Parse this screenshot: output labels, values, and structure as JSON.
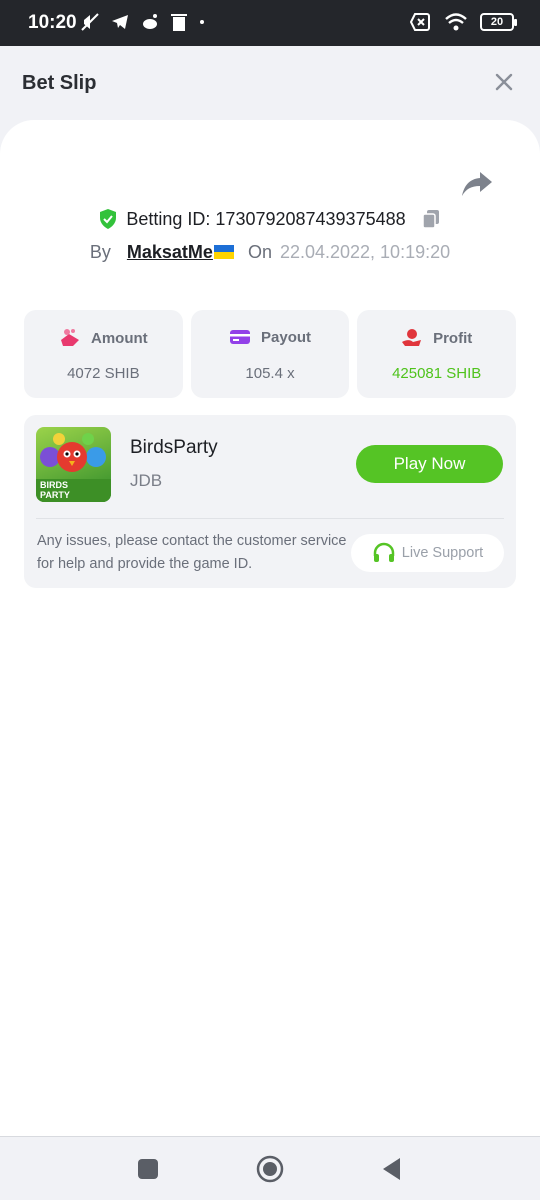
{
  "status_bar": {
    "time": "10:20",
    "battery": "20",
    "left_icons": [
      "mute-icon",
      "telegram-icon",
      "reddit-icon",
      "trash-icon",
      "dot-icon"
    ],
    "right_icons": [
      "no-sim-icon",
      "wifi-icon",
      "battery-icon"
    ]
  },
  "header": {
    "title": "Bet Slip"
  },
  "bet": {
    "id_label": "Betting ID: 1730792087439375488",
    "by_label": "By",
    "user": "MaksatMe",
    "on_label": "On",
    "date": "22.04.2022, 10:19:20"
  },
  "stats": {
    "amount": {
      "label": "Amount",
      "value": "4072 SHIB",
      "icon": "coins-hand-icon"
    },
    "payout": {
      "label": "Payout",
      "value": "105.4 x",
      "icon": "card-icon"
    },
    "profit": {
      "label": "Profit",
      "value": "425081 SHIB",
      "icon": "hand-money-icon"
    }
  },
  "game": {
    "name": "BirdsParty",
    "provider": "JDB",
    "thumb_text": "BIRDS PARTY",
    "play_label": "Play Now",
    "issue_text": "Any issues, please contact the customer service for help and provide the game ID.",
    "support_label": "Live Support"
  },
  "colors": {
    "accent_green": "#55c425",
    "profit_green": "#4fc31c",
    "shield_green": "#33c23b",
    "amount_pink": "#e8396e",
    "payout_purple": "#9240e8",
    "profit_red": "#e0353c"
  }
}
